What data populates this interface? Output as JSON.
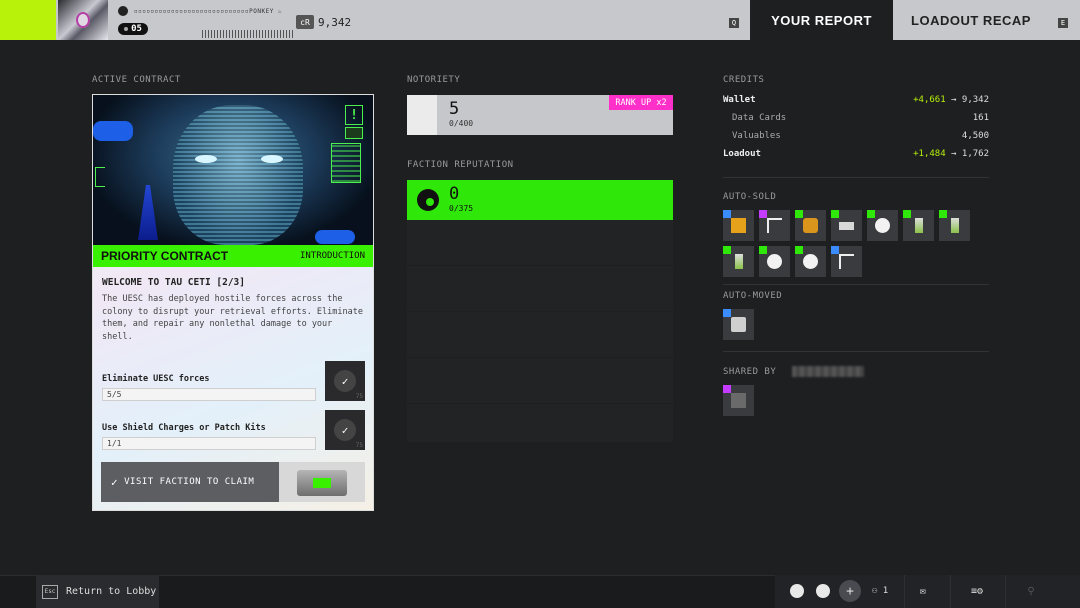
{
  "header": {
    "player_name": "▫▫▫▫▫▫▫▫▫▫▫▫▫▫▫▫▫▫▫▫▫▫▫▫▫▫▫▫PONKEY ♨",
    "level": "05",
    "credits_badge": "cR",
    "credits_value": "9,342",
    "tab_report": "YOUR REPORT",
    "tab_recap": "LOADOUT RECAP",
    "key_left": "Q",
    "key_right": "E"
  },
  "contract": {
    "section_label": "ACTIVE CONTRACT",
    "alert": "!",
    "title": "PRIORITY CONTRACT",
    "tag": "INTRODUCTION",
    "heading": "WELCOME TO TAU CETI [2/3]",
    "description": "The UESC has deployed hostile forces across the colony to disrupt your retrieval efforts. Eliminate them, and repair any nonlethal damage to your shell.",
    "objectives": [
      {
        "label": "Eliminate UESC forces",
        "progress": "5/5",
        "reward": "75"
      },
      {
        "label": "Use Shield Charges or Patch Kits",
        "progress": "1/1",
        "reward": "75"
      }
    ],
    "claim_label": "VISIT FACTION TO CLAIM"
  },
  "notoriety": {
    "section_label": "NOTORIETY",
    "value": "5",
    "progress": "0/400",
    "rank_up": "RANK UP x2"
  },
  "faction": {
    "section_label": "FACTION REPUTATION",
    "value": "0",
    "progress": "0/375"
  },
  "credits": {
    "section_label": "CREDITS",
    "wallet_label": "Wallet",
    "wallet_gain": "+4,661",
    "wallet_total": "9,342",
    "data_cards_label": "Data Cards",
    "data_cards_value": "161",
    "valuables_label": "Valuables",
    "valuables_value": "4,500",
    "loadout_label": "Loadout",
    "loadout_gain": "+1,484",
    "loadout_total": "1,762",
    "arrow": "→"
  },
  "auto_sold": {
    "section_label": "AUTO-SOLD",
    "items": [
      {
        "rarity": "#3a8cff",
        "icon": "crate-icon"
      },
      {
        "rarity": "#c43cff",
        "icon": "glyph-icon"
      },
      {
        "rarity": "#2fe80a",
        "icon": "canister-icon"
      },
      {
        "rarity": "#2fe80a",
        "icon": "chip-icon"
      },
      {
        "rarity": "#2fe80a",
        "icon": "faction-logo-icon"
      },
      {
        "rarity": "#2fe80a",
        "icon": "vial-icon"
      },
      {
        "rarity": "#2fe80a",
        "icon": "vial-icon"
      },
      {
        "rarity": "#2fe80a",
        "icon": "vial-icon"
      },
      {
        "rarity": "#2fe80a",
        "icon": "faction-logo-icon"
      },
      {
        "rarity": "#2fe80a",
        "icon": "faction-logo-icon"
      },
      {
        "rarity": "#3a8cff",
        "icon": "glyph-icon"
      }
    ]
  },
  "auto_moved": {
    "section_label": "AUTO-MOVED",
    "items": [
      {
        "rarity": "#3a8cff",
        "icon": "module-icon"
      }
    ]
  },
  "shared": {
    "section_label": "SHARED BY",
    "items": [
      {
        "rarity": "#c43cff",
        "icon": "box-icon"
      }
    ]
  },
  "footer": {
    "esc_key": "Esc",
    "return_label": "Return to Lobby",
    "party_count": "1",
    "plus": "+"
  },
  "colors": {
    "accent_green": "#39f000",
    "lime": "#b8f20a",
    "pink": "#ff2fc9"
  }
}
